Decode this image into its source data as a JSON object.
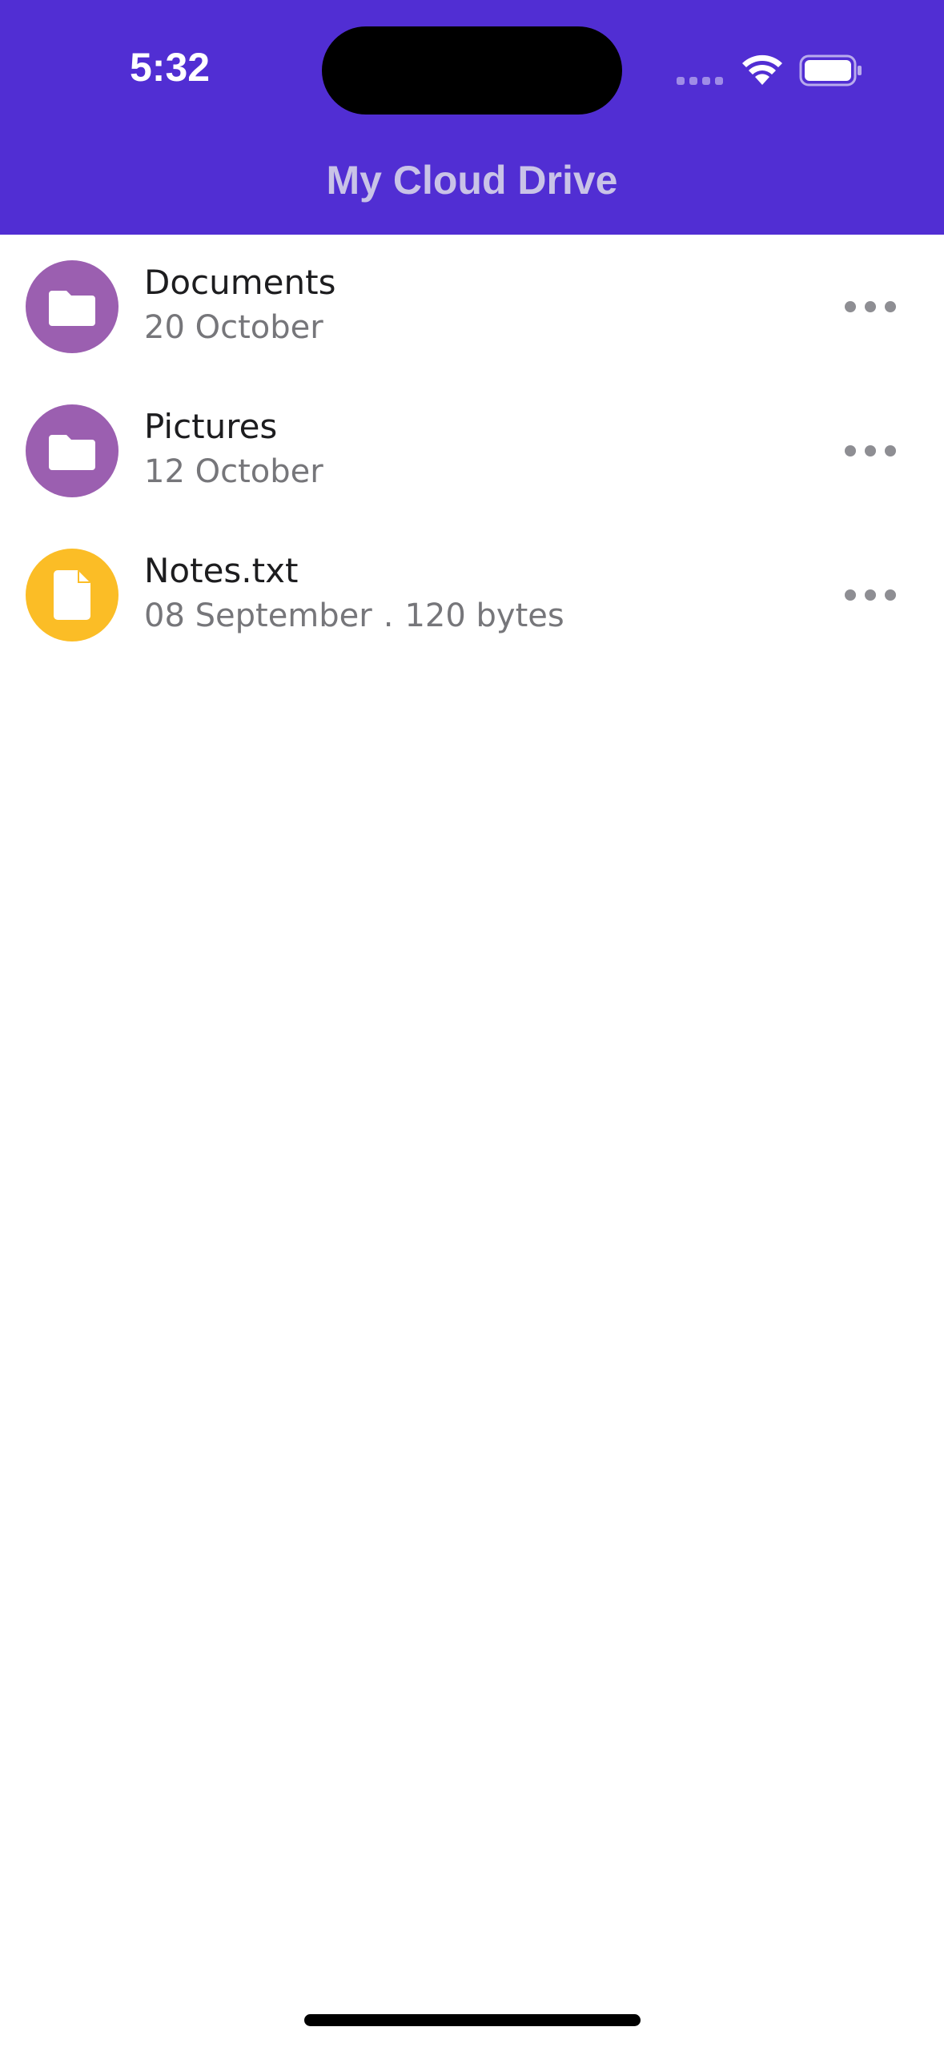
{
  "status_bar": {
    "time": "5:32"
  },
  "header": {
    "title": "My Cloud Drive",
    "background_color": "#512ed3"
  },
  "items": [
    {
      "name": "Documents",
      "date": "20 October",
      "type": "folder",
      "icon": "folder-icon",
      "icon_color": "#9b5fb0"
    },
    {
      "name": "Pictures",
      "date": "12 October",
      "type": "folder",
      "icon": "folder-icon",
      "icon_color": "#9b5fb0"
    },
    {
      "name": "Notes.txt",
      "date": "08 September",
      "separator": ".",
      "size": "120 bytes",
      "type": "file",
      "icon": "file-icon",
      "icon_color": "#fbbd26"
    }
  ]
}
